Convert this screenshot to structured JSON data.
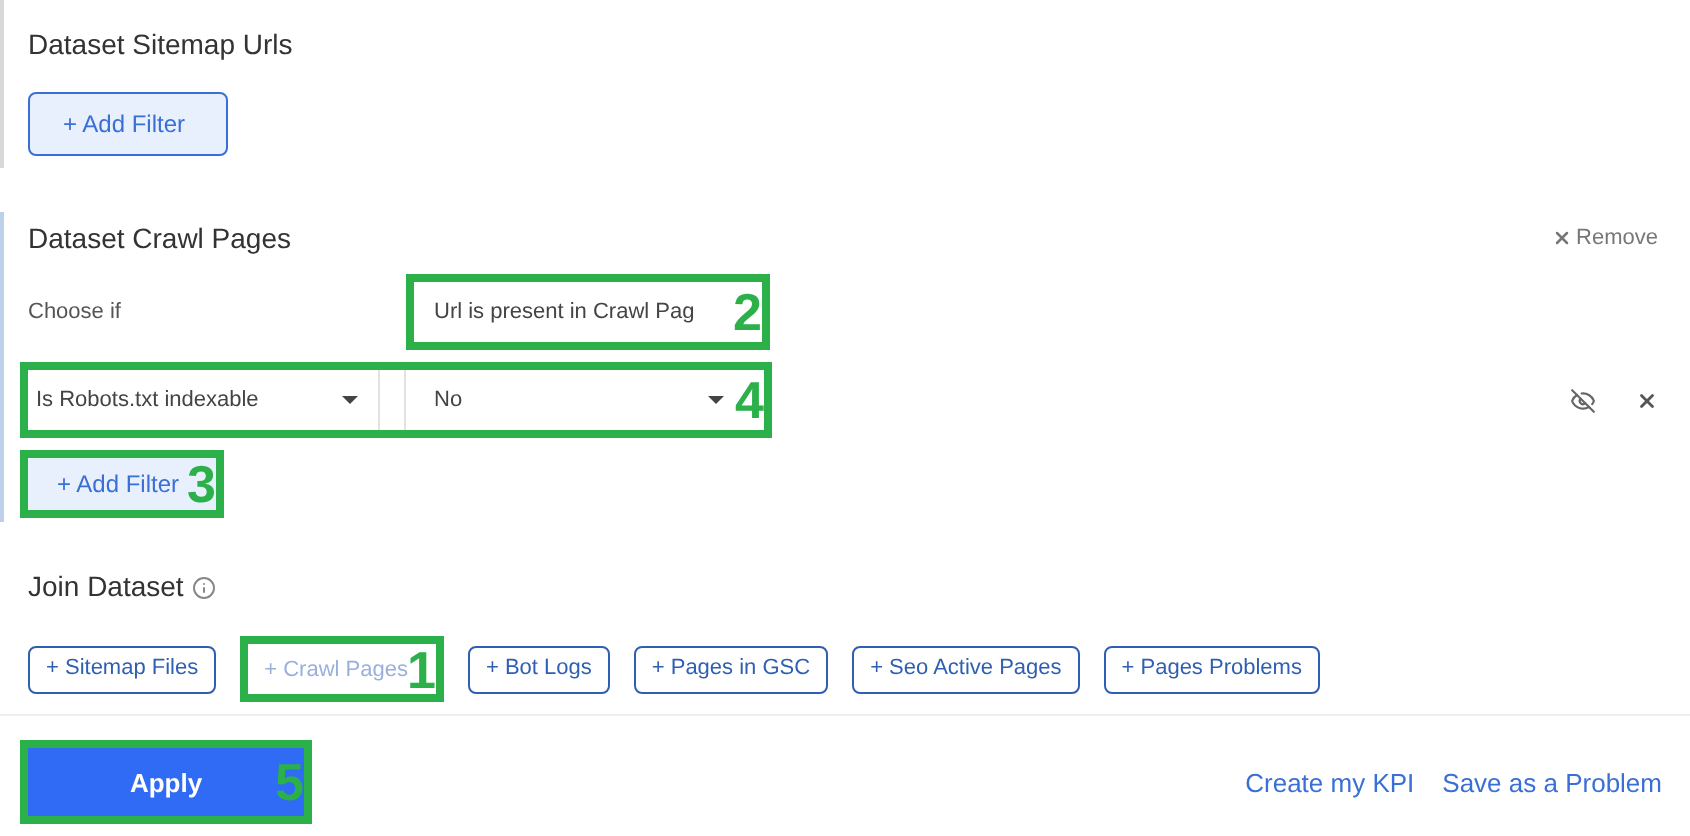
{
  "sections": [
    {
      "title": "Dataset Sitemap Urls",
      "add_filter": {
        "label": "+ Add Filter",
        "kind": "outlined"
      }
    },
    {
      "title": "Dataset Crawl Pages",
      "remove": "Remove",
      "choose_if": {
        "label": "Choose if",
        "value": "Url is present in Crawl Pag",
        "callout": "2"
      },
      "filters": [
        {
          "field": "Is Robots.txt indexable",
          "value": "No",
          "hidden": true,
          "callout": "4"
        }
      ],
      "add_filter": {
        "label": "+ Add Filter",
        "kind": "flat",
        "callout": "3"
      }
    }
  ],
  "join": {
    "title": "Join Dataset",
    "buttons": [
      {
        "label": "+ Sitemap Files",
        "disabled": false
      },
      {
        "label": "+ Crawl Pages",
        "disabled": true,
        "callout": "1"
      },
      {
        "label": "+ Bot Logs",
        "disabled": false
      },
      {
        "label": "+ Pages in GSC",
        "disabled": false
      },
      {
        "label": "+ Seo Active Pages",
        "disabled": false
      },
      {
        "label": "+ Pages Problems",
        "disabled": false
      }
    ]
  },
  "footer": {
    "apply": {
      "label": "Apply",
      "callout": "5"
    },
    "links": [
      "Create my KPI",
      "Save as a Problem"
    ]
  }
}
